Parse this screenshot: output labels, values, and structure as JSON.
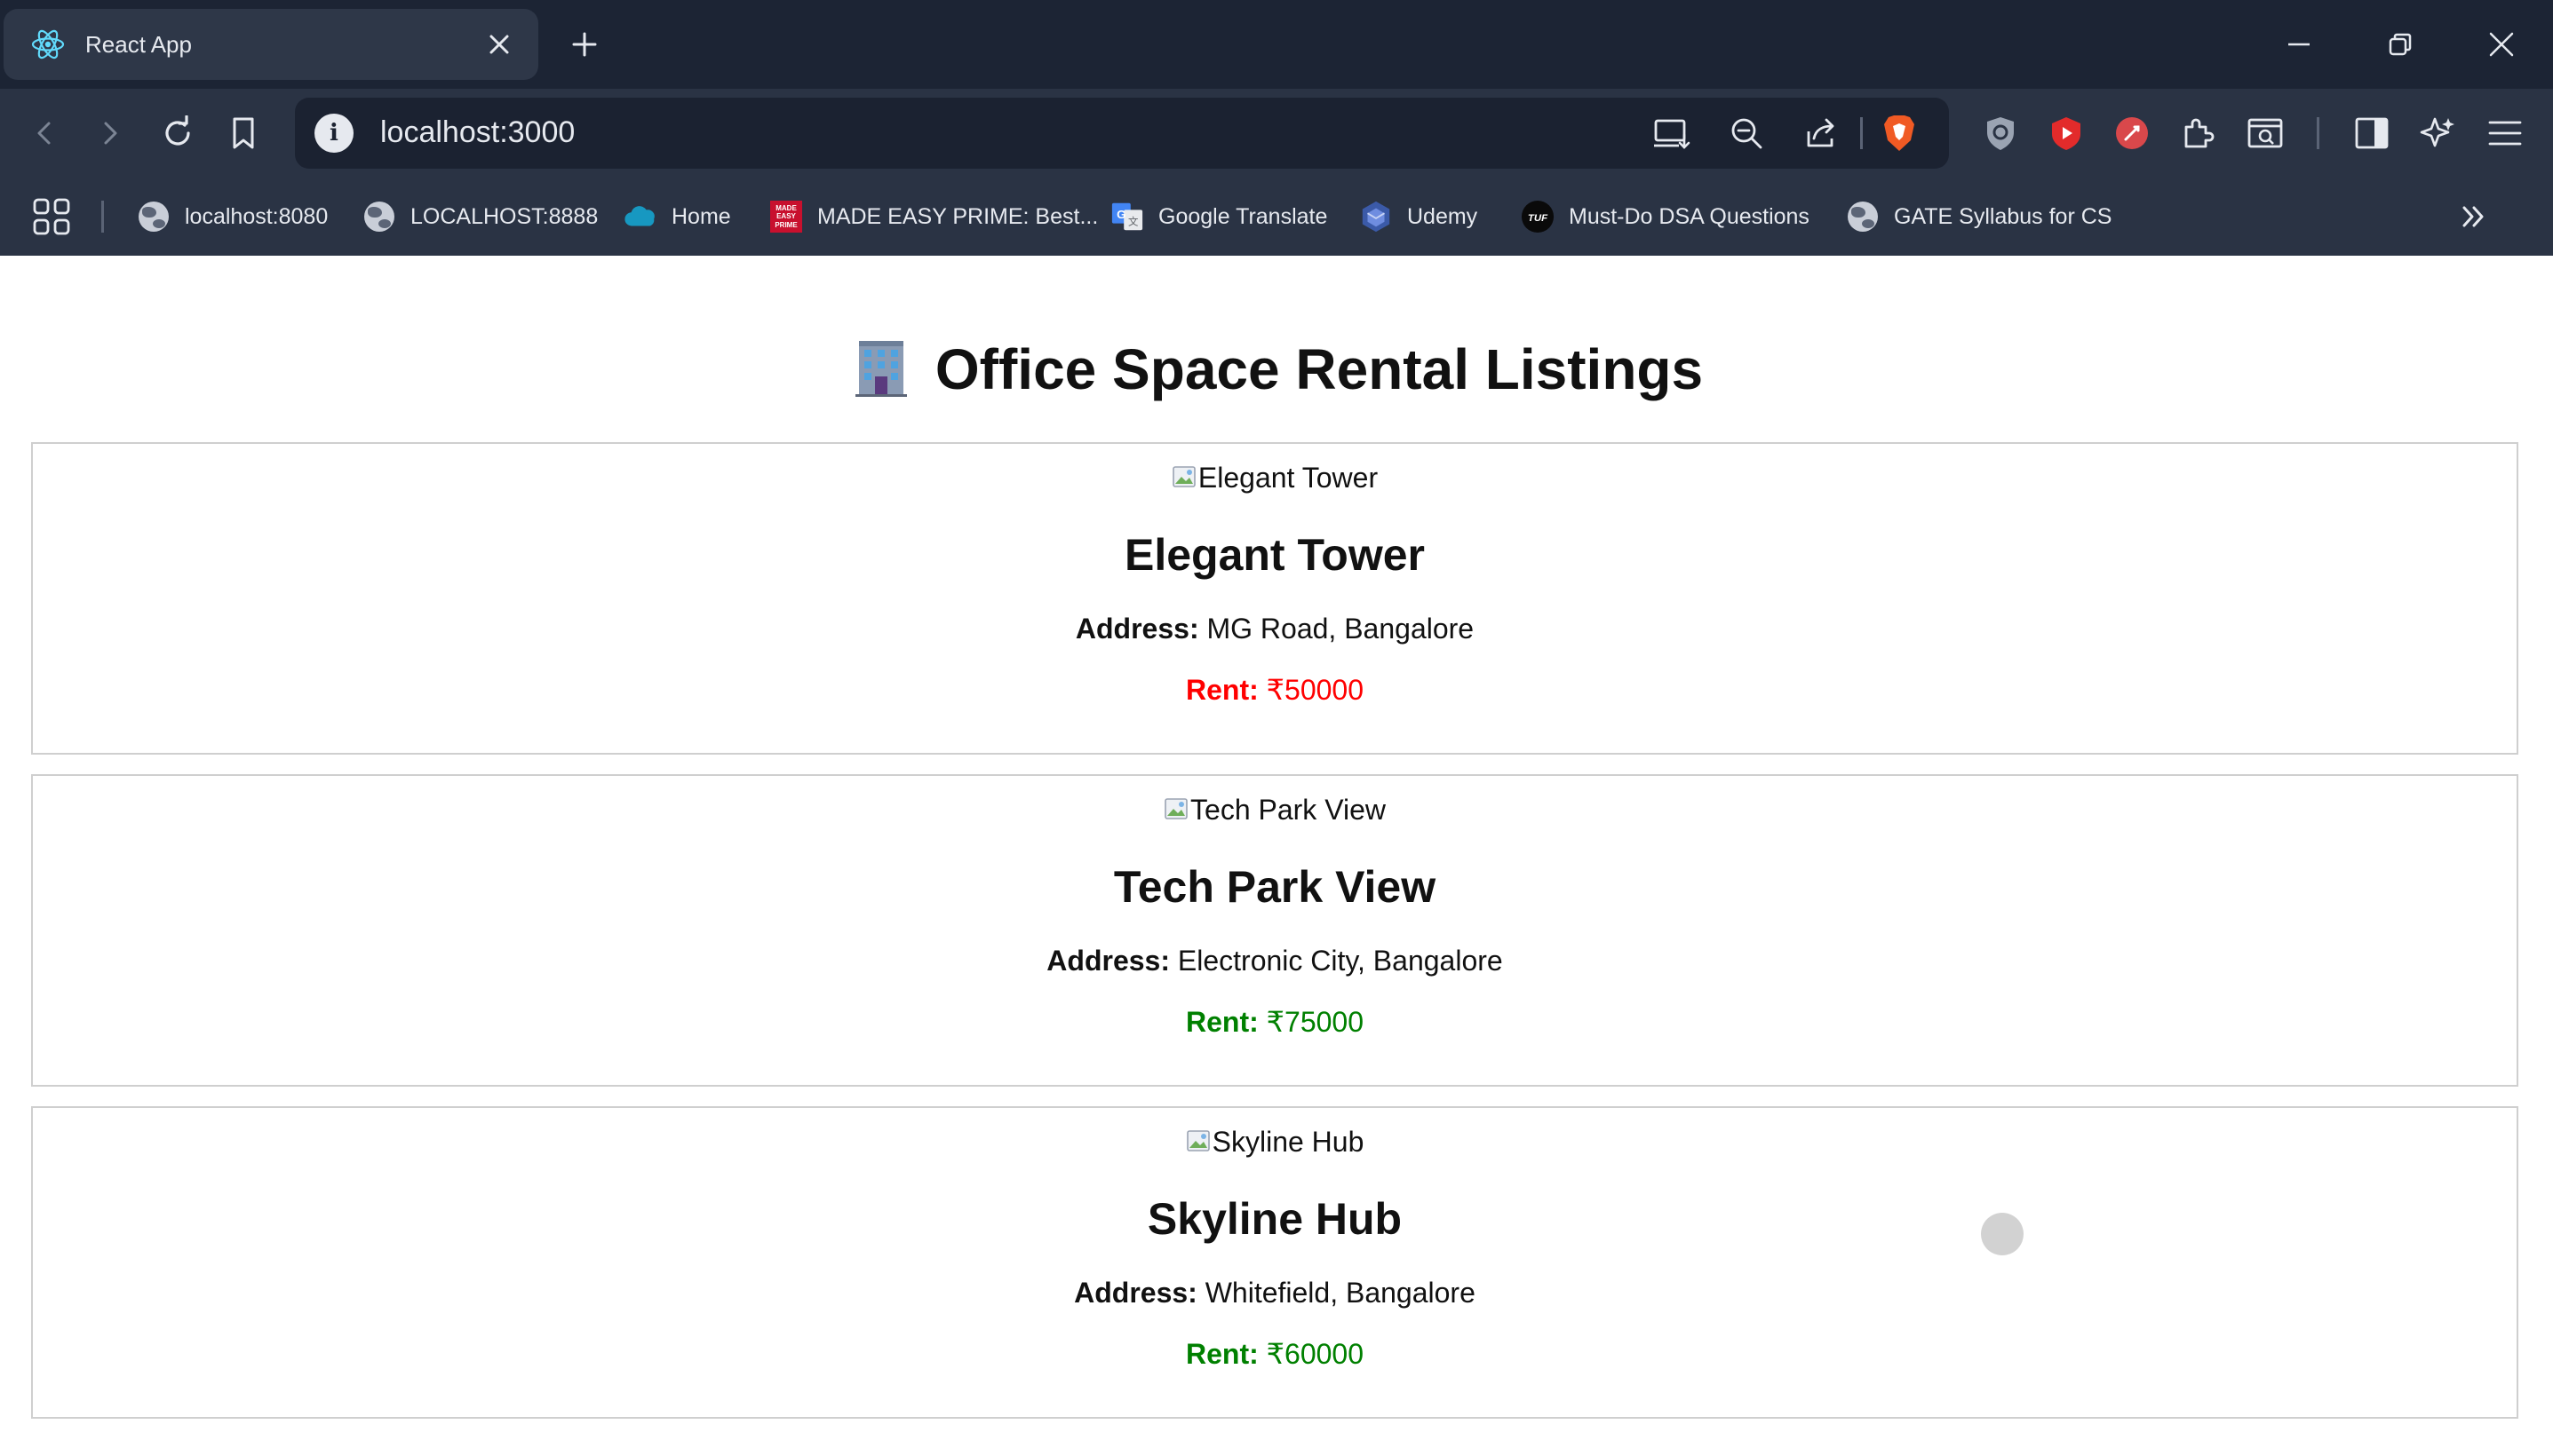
{
  "browser": {
    "tab": {
      "title": "React App",
      "favicon": "react-icon"
    },
    "address_bar": {
      "url": "localhost:3000"
    },
    "bookmarks": [
      {
        "label": "localhost:8080",
        "icon": "globe-icon"
      },
      {
        "label": "LOCALHOST:8888",
        "icon": "globe-icon"
      },
      {
        "label": "Home",
        "icon": "salesforce-cloud-icon"
      },
      {
        "label": "MADE EASY PRIME: Best...",
        "icon": "made-easy-icon",
        "icon_text": "MADE EASY PRIME"
      },
      {
        "label": "Google Translate",
        "icon": "google-translate-icon"
      },
      {
        "label": "Udemy",
        "icon": "udemy-icon"
      },
      {
        "label": "Must-Do DSA Questions",
        "icon": "tuf-icon",
        "icon_text": "TUF"
      },
      {
        "label": "GATE Syllabus for CS",
        "icon": "globe-icon"
      }
    ],
    "colors": {
      "tabstrip": "#1c2434",
      "toolbar": "#2a3344",
      "active_tab": "#2e3748",
      "brave_orange": "#f05a24"
    }
  },
  "page": {
    "title": "Office Space Rental Listings",
    "title_icon": "office-building-icon",
    "listings": [
      {
        "image_alt": "Elegant Tower",
        "name": "Elegant Tower",
        "address_label": "Address:",
        "address": "MG Road, Bangalore",
        "rent_label": "Rent:",
        "rent": "₹50000",
        "rent_color": "#ff0000"
      },
      {
        "image_alt": "Tech Park View",
        "name": "Tech Park View",
        "address_label": "Address:",
        "address": "Electronic City, Bangalore",
        "rent_label": "Rent:",
        "rent": "₹75000",
        "rent_color": "#008000"
      },
      {
        "image_alt": "Skyline Hub",
        "name": "Skyline Hub",
        "address_label": "Address:",
        "address": "Whitefield, Bangalore",
        "rent_label": "Rent:",
        "rent": "₹60000",
        "rent_color": "#008000"
      }
    ]
  }
}
